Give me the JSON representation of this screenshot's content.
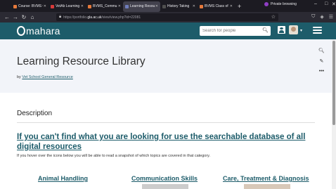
{
  "browser": {
    "tabs": [
      {
        "label": "Course: BVMS Co",
        "favicon_color": "#e5793b",
        "active": false
      },
      {
        "label": "VetAb Learning",
        "favicon_color": "#d83a3a",
        "active": false
      },
      {
        "label": "BVMS_Commu",
        "favicon_color": "#e5793b",
        "active": false
      },
      {
        "label": "Learning Resou",
        "favicon_color": "#6f7dbb",
        "active": true
      },
      {
        "label": "History Taking",
        "favicon_color": "#4f4f4f",
        "active": false
      },
      {
        "label": "BVMS Class of",
        "favicon_color": "#e5793b",
        "active": false
      }
    ],
    "new_tab": "+",
    "private_label": "Private browsing",
    "url_prefix": "https://portfolio.",
    "url_host": "gla.ac.uk",
    "url_path": "/view/view.php?id=22081",
    "colors": {
      "accent": "#1d5c6a",
      "private": "#8f3ec5"
    }
  },
  "header": {
    "logo_text": "mahara",
    "search_placeholder": "Search for people"
  },
  "page": {
    "title": "Learning Resource Library",
    "by_prefix": "by",
    "author": "Vet School General Resource",
    "section_heading": "Description",
    "main_link": "If you can't find what you are looking for use the searchable database of all digital resources",
    "hover_text": "If you hover over the icons below you will be able to read a snapshot of which topics are covered in that category.",
    "categories": [
      "Animal Handling",
      "Communication Skills",
      "Care, Treatment & Diagnosis"
    ]
  },
  "icons": {
    "zoom": "zoom-icon",
    "edit": "pencil-icon",
    "more": "more-icon"
  }
}
